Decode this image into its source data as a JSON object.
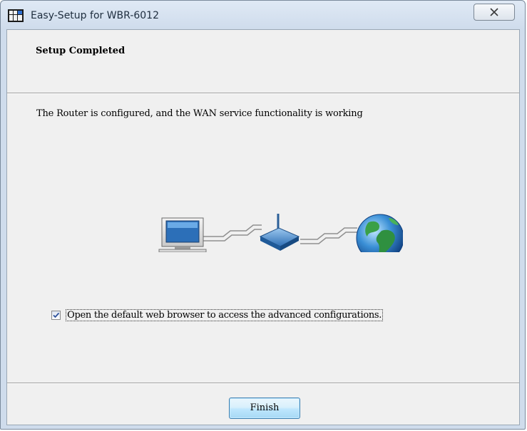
{
  "window": {
    "title": "Easy-Setup for WBR-6012"
  },
  "header": {
    "title": "Setup Completed"
  },
  "main": {
    "message": "The Router is configured, and the WAN service functionality is working",
    "checkbox": {
      "label": "Open the default web browser to access the advanced configurations.",
      "checked": true
    }
  },
  "footer": {
    "finish_label": "Finish"
  },
  "icons": {
    "app": "app-logo-icon",
    "close": "close-icon",
    "computer": "computer-icon",
    "router": "router-icon",
    "globe": "globe-icon"
  }
}
